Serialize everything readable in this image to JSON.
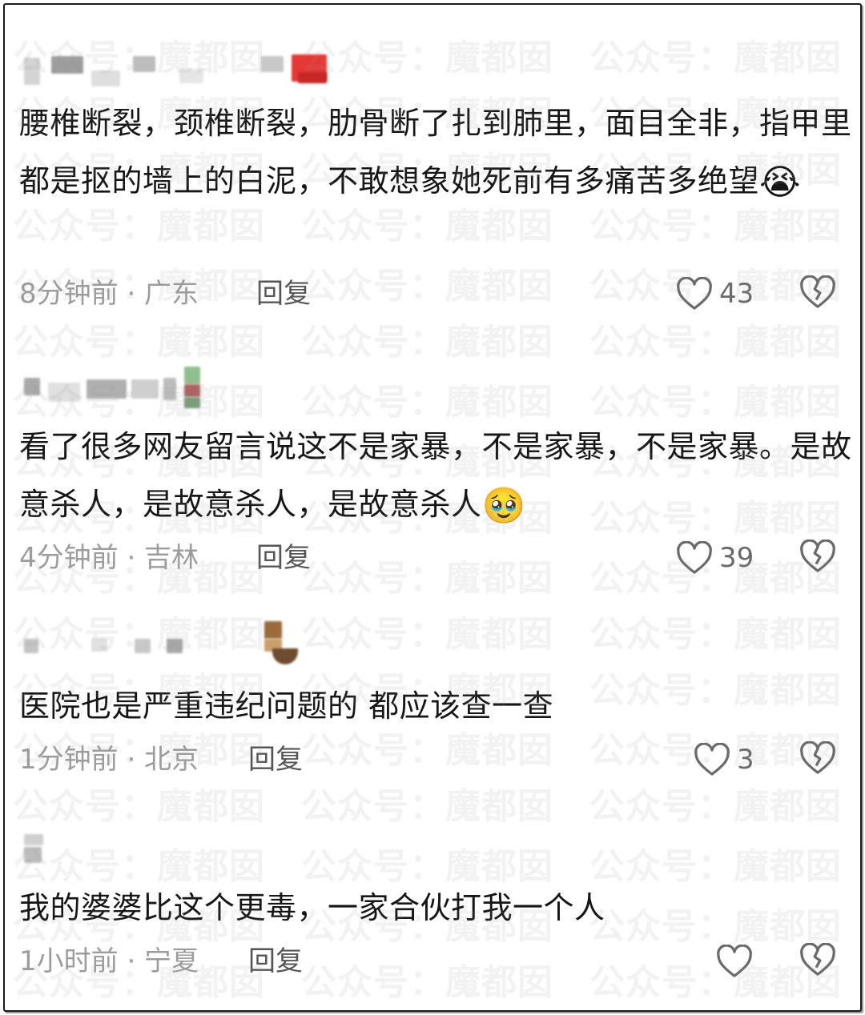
{
  "watermark": "公众号：魔都囡",
  "comments": [
    {
      "text": "腰椎断裂，颈椎断裂，肋骨断了扎到肺里，面目全非，指甲里都是抠的墙上的白泥，不敢想象她死前有多痛苦多绝望",
      "emoji": "😭",
      "time_location": "8分钟前 · 广东",
      "reply_label": "回复",
      "like_count": "43"
    },
    {
      "text": "看了很多网友留言说这不是家暴，不是家暴，不是家暴。是故意杀人，是故意杀人，是故意杀人",
      "emoji": "🥹",
      "time_location": "4分钟前 · 吉林",
      "reply_label": "回复",
      "like_count": "39"
    },
    {
      "text": "医院也是严重违纪问题的 都应该查一查",
      "emoji": "",
      "time_location": "1分钟前 · 北京",
      "reply_label": "回复",
      "like_count": "3"
    },
    {
      "text": "我的婆婆比这个更毒，一家合伙打我一个人",
      "emoji": "",
      "time_location": "1小时前 · 宁夏",
      "reply_label": "回复",
      "like_count": ""
    }
  ],
  "colors": {
    "text": "#161616",
    "meta": "#9c9c9c",
    "reply": "#565656",
    "icon": "#6a6a6a"
  }
}
